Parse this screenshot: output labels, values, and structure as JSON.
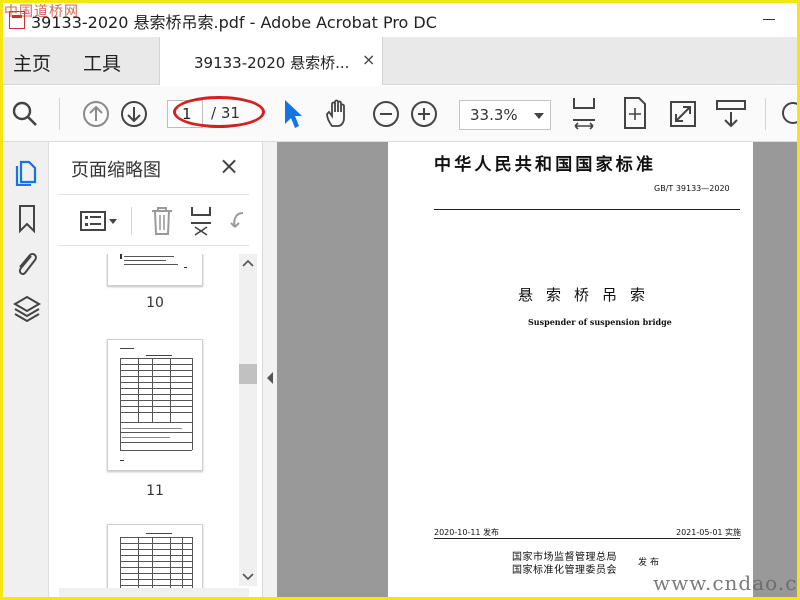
{
  "window": {
    "title": "39133-2020 悬索桥吊索.pdf - Adobe Acrobat Pro DC",
    "watermark_top": "中国道桥网"
  },
  "tabs": {
    "home": "主页",
    "tools": "工具",
    "document": "39133-2020 悬索桥...",
    "close": "×"
  },
  "toolbar": {
    "page_current": "1",
    "page_total": "/ 31",
    "zoom": "33.3%",
    "highlight_color": "#d42020",
    "accent_color": "#1473e6"
  },
  "thumbnail_panel": {
    "title": "页面缩略图",
    "close": "×",
    "thumbnails": [
      {
        "page": "10"
      },
      {
        "page": "11"
      }
    ]
  },
  "document": {
    "standard_title": "中华人民共和国国家标准",
    "standard_code": "GB/T 39133—2020",
    "name_zh": "悬索桥吊索",
    "name_en": "Suspender of suspension bridge",
    "issue_date": "2020-10-11 发布",
    "implement_date": "2021-05-01 实施",
    "issuer_1": "国家市场监督管理总局",
    "issuer_2": "国家标准化管理委员会",
    "release": "发布"
  },
  "watermark_bottom": "www.cndao.c"
}
